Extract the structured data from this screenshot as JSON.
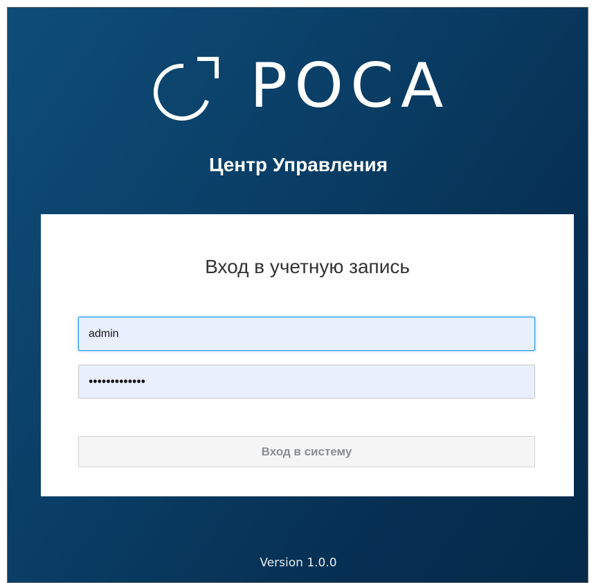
{
  "brand": {
    "logo_text": "РОСА",
    "subtitle": "Центр Управления"
  },
  "login": {
    "title": "Вход в учетную запись",
    "username_value": "admin",
    "password_value": "•••••••••••••",
    "submit_label": "Вход в систему"
  },
  "footer": {
    "version": "Version 1.0.0"
  },
  "icons": {
    "logo_mark": "rosa-logo-mark-icon"
  },
  "colors": {
    "background_top": "#0e4d78",
    "background_bottom": "#052a4a",
    "input_fill": "#e8f0fe",
    "focus_border": "#2b9af3",
    "button_fill": "#f5f5f5",
    "button_text": "#8a8d90"
  }
}
